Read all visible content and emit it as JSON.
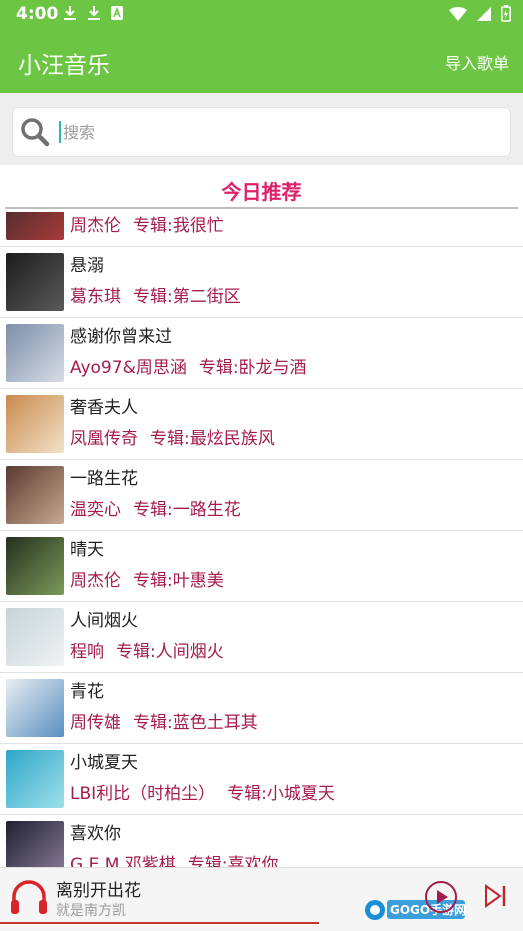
{
  "status_bar": {
    "time": "4:00"
  },
  "app_bar": {
    "title": "小汪音乐",
    "import_label": "导入歌单"
  },
  "search": {
    "placeholder": "搜索"
  },
  "section_title": "今日推荐",
  "songs": [
    {
      "title": "",
      "artist": "周杰伦",
      "album": "专辑:我很忙",
      "cover_colors": [
        "#3a2a2a",
        "#a83a3a"
      ]
    },
    {
      "title": "悬溺",
      "artist": "葛东琪",
      "album": "专辑:第二街区",
      "cover_colors": [
        "#1c1c1c",
        "#5a5a5a"
      ]
    },
    {
      "title": "感谢你曾来过",
      "artist": "Ayo97&周思涵",
      "album": "专辑:卧龙与酒",
      "cover_colors": [
        "#7d8fa8",
        "#d8dce6"
      ]
    },
    {
      "title": "奢香夫人",
      "artist": "凤凰传奇",
      "album": "专辑:最炫民族风",
      "cover_colors": [
        "#c98a4e",
        "#f2e2c8"
      ]
    },
    {
      "title": "一路生花",
      "artist": "温奕心",
      "album": "专辑:一路生花",
      "cover_colors": [
        "#5a3a2e",
        "#c8a890"
      ]
    },
    {
      "title": "晴天",
      "artist": "周杰伦",
      "album": "专辑:叶惠美",
      "cover_colors": [
        "#24301e",
        "#7c9a5a"
      ]
    },
    {
      "title": "人间烟火",
      "artist": "程响",
      "album": "专辑:人间烟火",
      "cover_colors": [
        "#c6d4d8",
        "#f0f2f2"
      ]
    },
    {
      "title": "青花",
      "artist": "周传雄",
      "album": "专辑:蓝色土耳其",
      "cover_colors": [
        "#e8eef2",
        "#5a8fbf"
      ]
    },
    {
      "title": "小城夏天",
      "artist": "LBI利比（时柏尘）",
      "album": "专辑:小城夏天",
      "cover_colors": [
        "#2fa6c8",
        "#9ee0ea"
      ]
    },
    {
      "title": "喜欢你",
      "artist": "G.E.M.邓紫棋",
      "album": "专辑:喜欢你",
      "cover_colors": [
        "#202030",
        "#8a7f9a"
      ]
    }
  ],
  "player": {
    "title": "离别开出花",
    "artist": "就是南方凯",
    "progress": 0.61
  },
  "watermark": {
    "text": "GOGO手游网",
    "subtext": "www.gogo.cn"
  },
  "colors": {
    "primary": "#6cc644",
    "accent": "#e0226a",
    "meta": "#a51c4e"
  }
}
